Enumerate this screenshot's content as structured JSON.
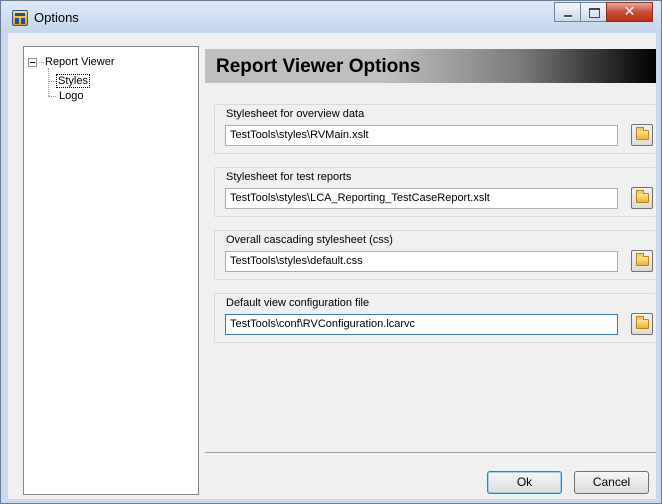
{
  "window": {
    "title": "Options",
    "icon": "options-app-icon",
    "close_glyph": "✕"
  },
  "tree": {
    "root_label": "Report Viewer",
    "children": [
      {
        "label": "Styles",
        "selected": true
      },
      {
        "label": "Logo",
        "selected": false
      }
    ]
  },
  "panel": {
    "title": "Report Viewer Options"
  },
  "groups": [
    {
      "label": "Stylesheet for overview data",
      "value": "TestTools\\styles\\RVMain.xslt"
    },
    {
      "label": "Stylesheet for test reports",
      "value": "TestTools\\styles\\LCA_Reporting_TestCaseReport.xslt"
    },
    {
      "label": "Overall cascading stylesheet (css)",
      "value": "TestTools\\styles\\default.css"
    },
    {
      "label": "Default view configuration file",
      "value": "TestTools\\conf\\RVConfiguration.lcarvc"
    }
  ],
  "buttons": {
    "ok": "Ok",
    "cancel": "Cancel"
  },
  "colors": {
    "header_gradient_start": "#bfbfbf",
    "header_gradient_end": "#000000",
    "focus_border": "#3d7bad"
  }
}
